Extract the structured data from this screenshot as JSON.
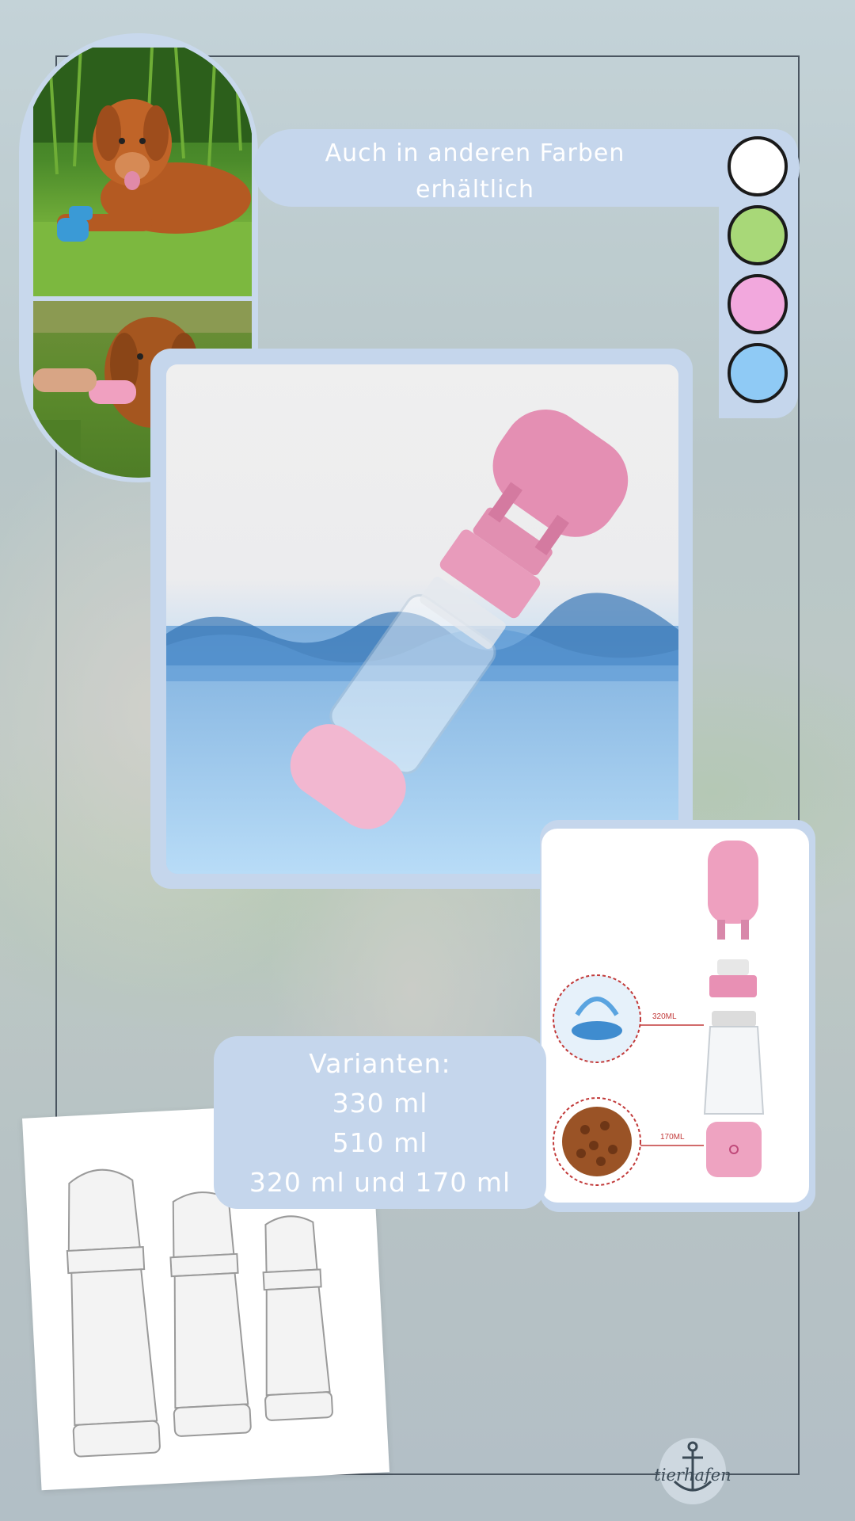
{
  "colors_banner": {
    "line1": "Auch in anderen Farben",
    "line2": "erhältlich"
  },
  "color_options": [
    {
      "name": "white",
      "hex": "#ffffff"
    },
    {
      "name": "green",
      "hex": "#a8d878"
    },
    {
      "name": "pink",
      "hex": "#f2a8dd"
    },
    {
      "name": "blue",
      "hex": "#8fcaf5"
    }
  ],
  "variants": {
    "title": "Varianten:",
    "items": [
      "330 ml",
      "510 ml",
      "320 ml und 170 ml"
    ]
  },
  "product_diagram": {
    "water_label": "320ML",
    "food_label": "170ML"
  },
  "brand": {
    "logo_text": "tierhafen",
    "logo_icon": "anchor-icon"
  },
  "theme": {
    "card_color": "#c5d6ec",
    "product_pink": "#eaa3c0"
  }
}
